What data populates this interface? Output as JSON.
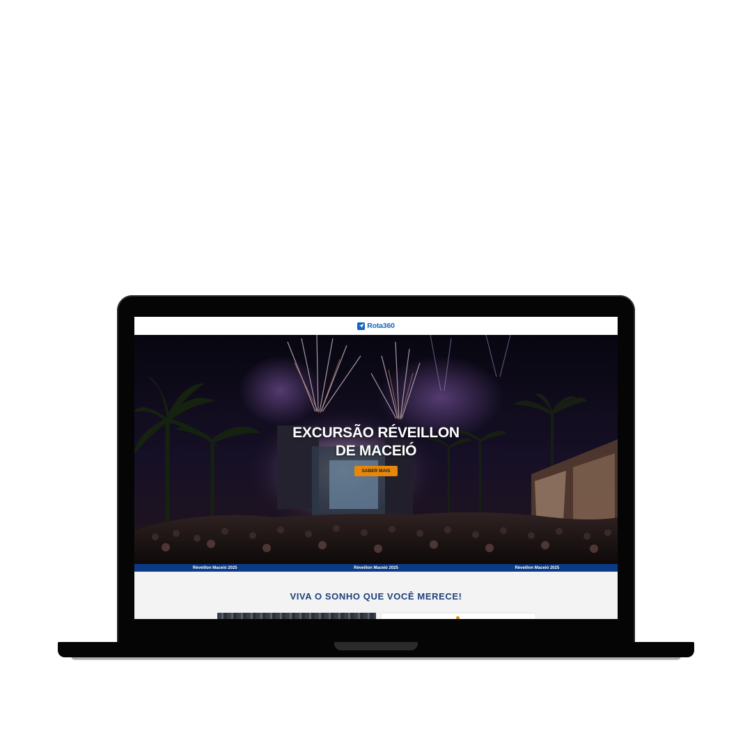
{
  "brand": {
    "name": "Rota360",
    "color": "#1565c0"
  },
  "hero": {
    "title_line1": "EXCURSÃO RÉVEILLON",
    "title_line2": "DE MACEIÓ",
    "cta_label": "SABER MAIS",
    "cta_color": "#e6860b"
  },
  "ticker": {
    "items": [
      "Réveillon Maceió 2025",
      "Réveillon Maceió 2025",
      "Réveillon Maceió 2025"
    ],
    "color": "#0b3b86"
  },
  "section": {
    "title": "VIVA O SONHO QUE VOCÊ MERECE!",
    "title_color": "#1d3f7a"
  }
}
